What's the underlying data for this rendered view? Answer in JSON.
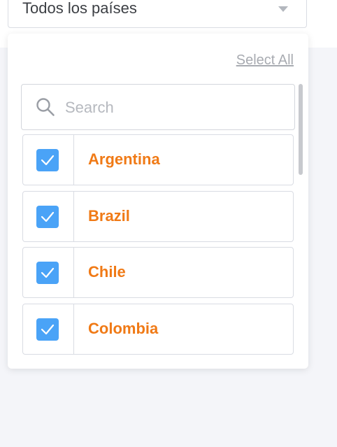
{
  "select": {
    "value": "Todos los países",
    "icon": "chevron-down-icon"
  },
  "dropdown": {
    "select_all_label": "Select All",
    "search": {
      "placeholder": "Search",
      "icon": "search-icon"
    },
    "options": [
      {
        "label": "Argentina",
        "checked": true
      },
      {
        "label": "Brazil",
        "checked": true
      },
      {
        "label": "Chile",
        "checked": true
      },
      {
        "label": "Colombia",
        "checked": true
      }
    ]
  },
  "colors": {
    "accent": "#4aa3f7",
    "option_text": "#f07a16",
    "muted_text": "#a8abb1",
    "border": "#d9dce3"
  }
}
